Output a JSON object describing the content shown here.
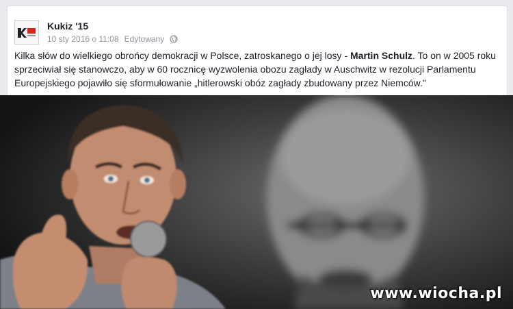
{
  "post": {
    "page_name": "Kukiz '15",
    "avatar_text": "KUKIZ'15",
    "date": "10 sty 2016 o 11:08",
    "edited": "Edytowany",
    "privacy_icon": "globe-icon",
    "text_part1": "Kilka słów do wielkiego obrońcy demokracji w Polsce, zatroskanego o jej losy - ",
    "text_bold": "Martin Schulz",
    "text_part2": ". To on w 2005 roku sprzeciwiał się stanowczo, aby w 60 rocznicę wyzwolenia obozu zagłady w Auschwitz w rezolucji Parlamentu Europejskiego pojawiło się sformułowanie „hitlerowski obóz zagłady zbudowany przez Niemców.\""
  },
  "photo": {
    "watermark": "www.wiocha.pl"
  },
  "colors": {
    "card_bg": "#ffffff",
    "page_bg": "#e9ebee",
    "meta_text": "#90949c",
    "body_text": "#1d2129",
    "avatar_red": "#d9261c"
  }
}
